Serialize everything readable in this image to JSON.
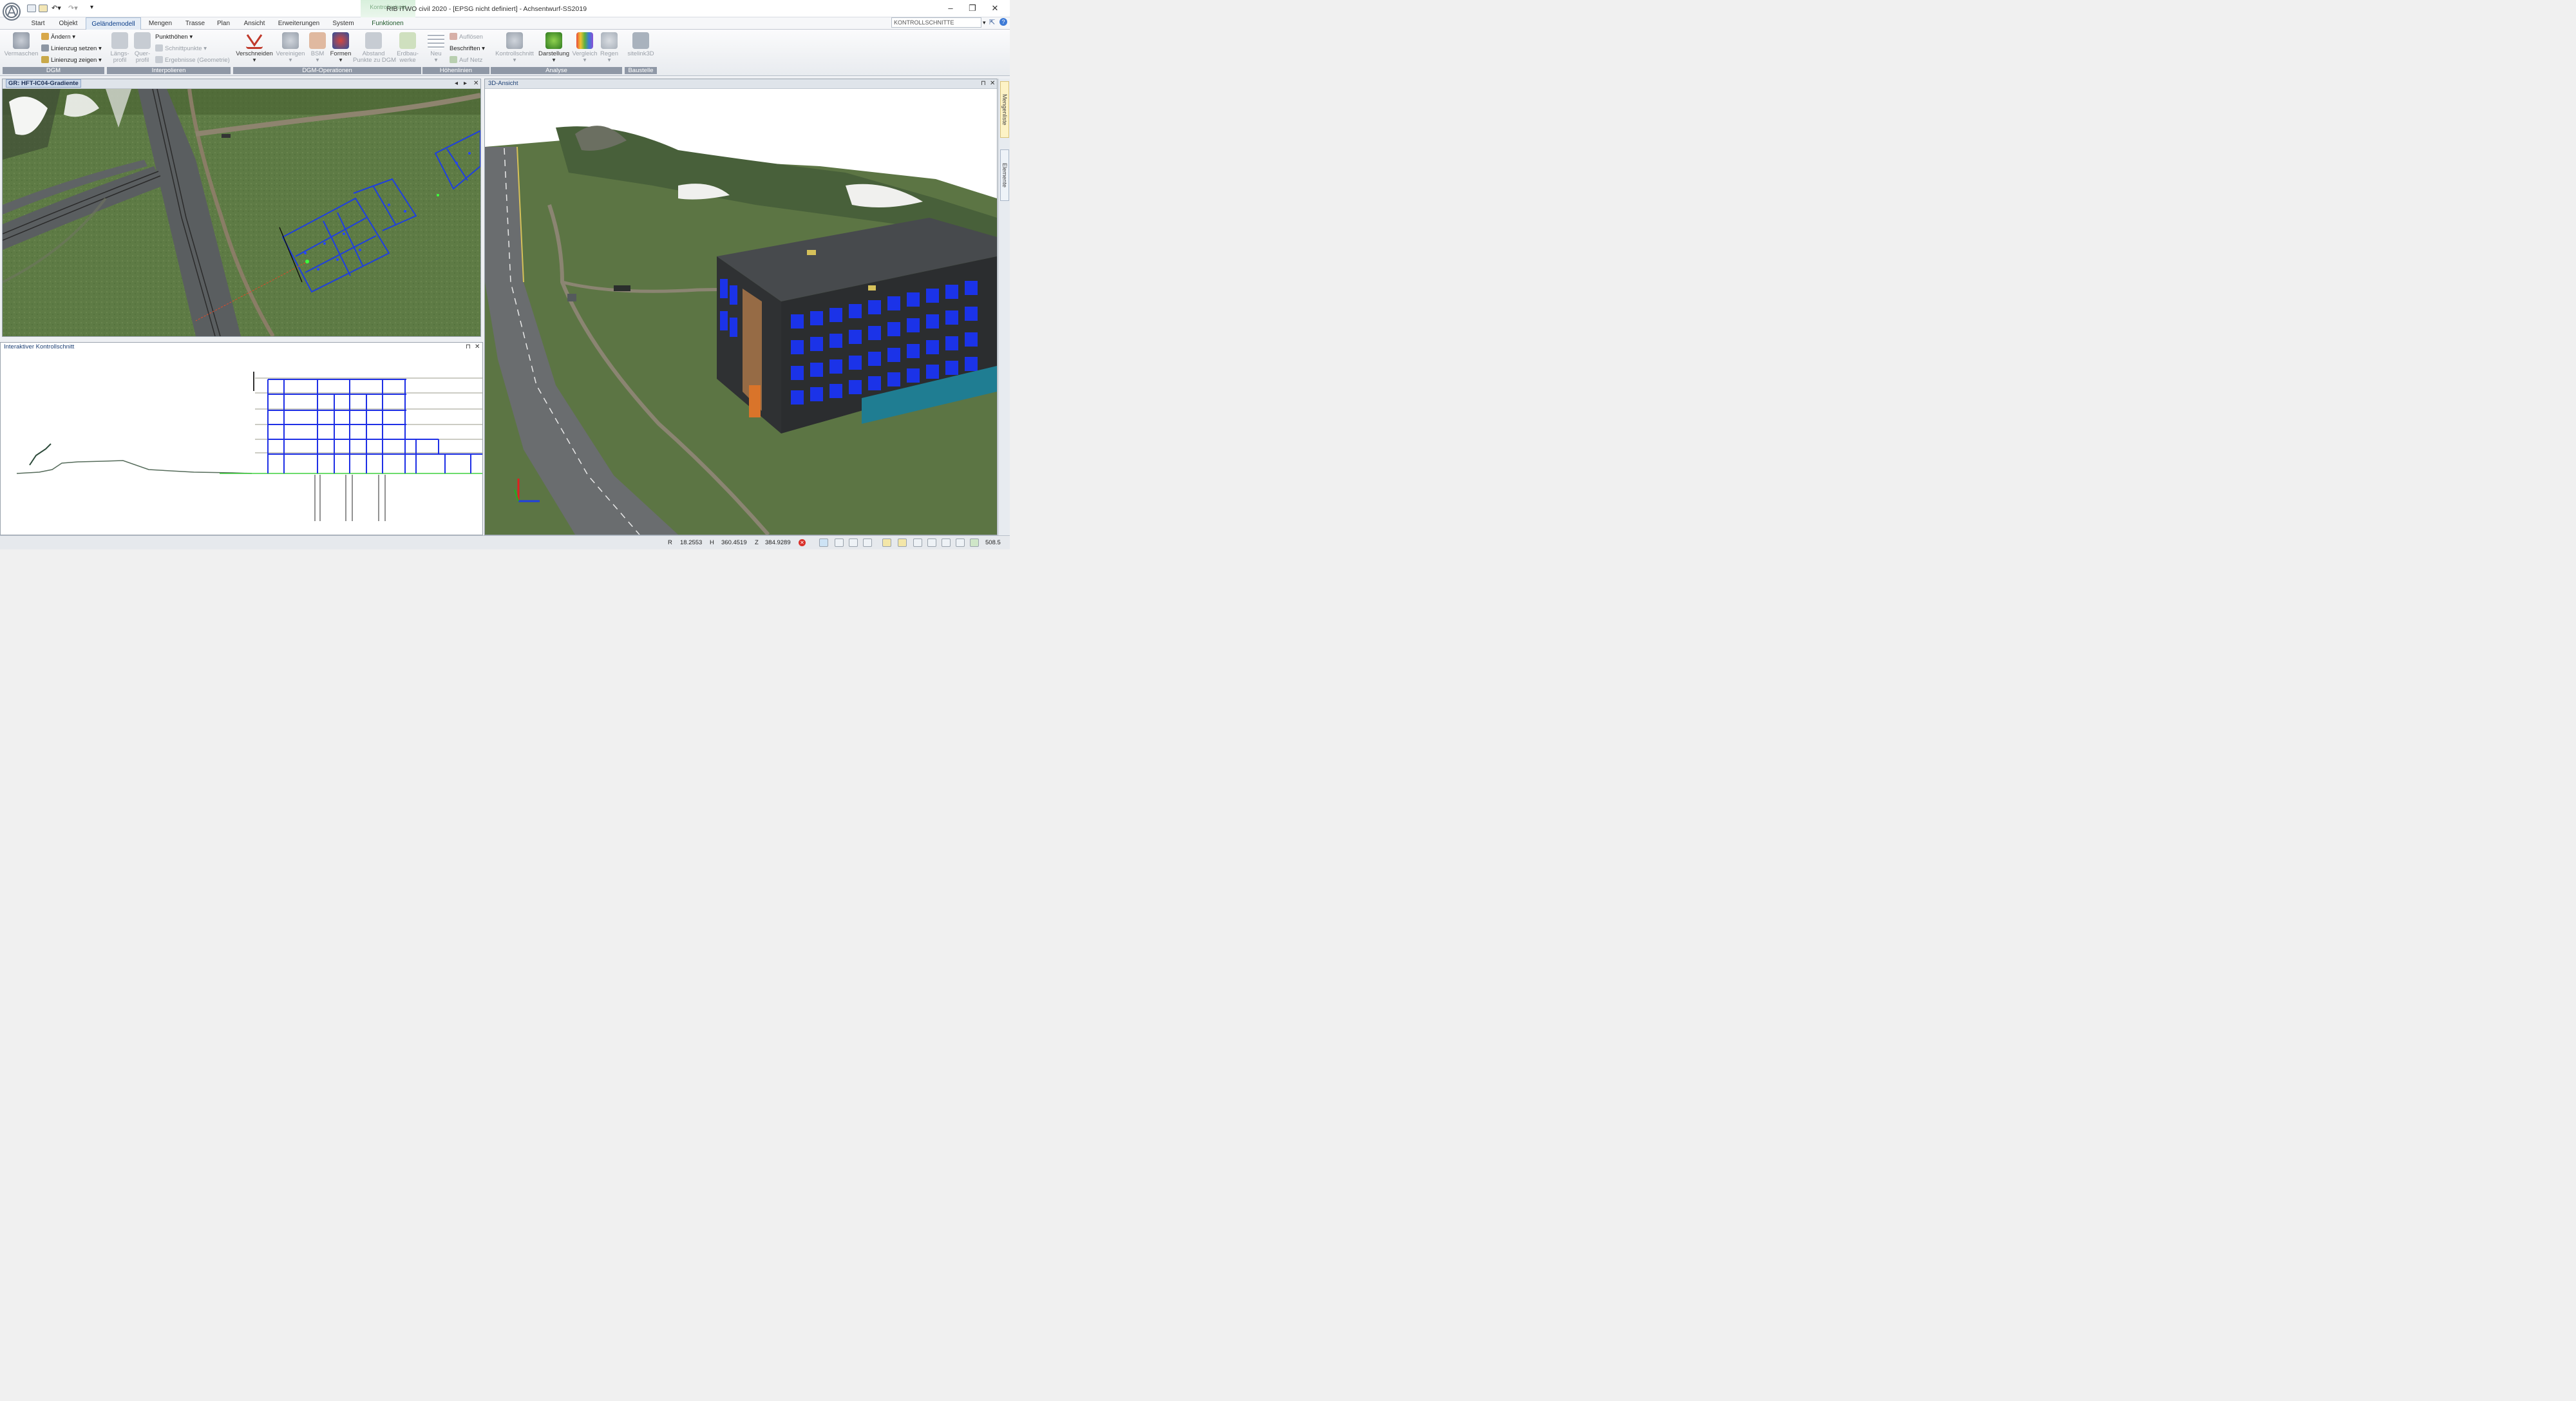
{
  "window": {
    "title": "RIB iTWO civil 2020 - [EPSG nicht definiert] - Achsentwurf-SS2019",
    "context_tab_header": "Kontrollschnitt",
    "minimize": "–",
    "restore": "❐",
    "close": "✕"
  },
  "tabs": [
    "Start",
    "Objekt",
    "Geländemodell",
    "Mengen",
    "Trasse",
    "Plan",
    "Ansicht",
    "Erweiterungen",
    "System",
    "Funktionen"
  ],
  "active_tab": "Geländemodell",
  "combo": {
    "value": "KONTROLLSCHNITTE"
  },
  "ribbon": {
    "dgm": {
      "label": "DGM",
      "vermaschen": "Vermaschen",
      "aendern": "Ändern",
      "linienzug_setzen": "Linienzug setzen",
      "linienzug_zeigen": "Linienzug zeigen"
    },
    "interpolieren": {
      "label": "Interpolieren",
      "laengs": "Längs-",
      "laengs2": "profil",
      "quer": "Quer-",
      "quer2": "profil",
      "punkthoehen": "Punkthöhen",
      "schnittpunkte": "Schnittpunkte",
      "ergebnisse": "Ergebnisse (Geometrie)"
    },
    "dgm_op": {
      "label": "DGM-Operationen",
      "verschneiden": "Verschneiden",
      "vereinigen": "Vereinigen",
      "bsm": "BSM",
      "formen": "Formen",
      "abstand": "Abstand",
      "abstand2": "Punkte zu DGM",
      "erdbau": "Erdbau-",
      "erdbau2": "werke"
    },
    "hoehenlinien": {
      "label": "Höhenlinien",
      "neu": "Neu",
      "aufloesen": "Auflösen",
      "beschriften": "Beschriften",
      "auf_netz": "Auf Netz"
    },
    "analyse": {
      "label": "Analyse",
      "kontrollschnitt": "Kontrollschnitt",
      "darstellung": "Darstellung",
      "vergleich": "Vergleich",
      "regen": "Regen"
    },
    "baustelle": {
      "label": "Baustelle",
      "sitelink": "sitelink3D"
    }
  },
  "panes": {
    "plan": {
      "title": "GR: HFT-IC04-Gradiente"
    },
    "section": {
      "title": "Interaktiver Kontrollschnitt"
    },
    "view3d": {
      "title": "3D-Ansicht"
    }
  },
  "side_tabs": [
    "Mengenliste",
    "Elemente"
  ],
  "status": {
    "r_label": "R",
    "r": "18.2553",
    "h_label": "H",
    "h": "360.4519",
    "z_label": "Z",
    "z": "384.9289",
    "scale": "508.5"
  }
}
